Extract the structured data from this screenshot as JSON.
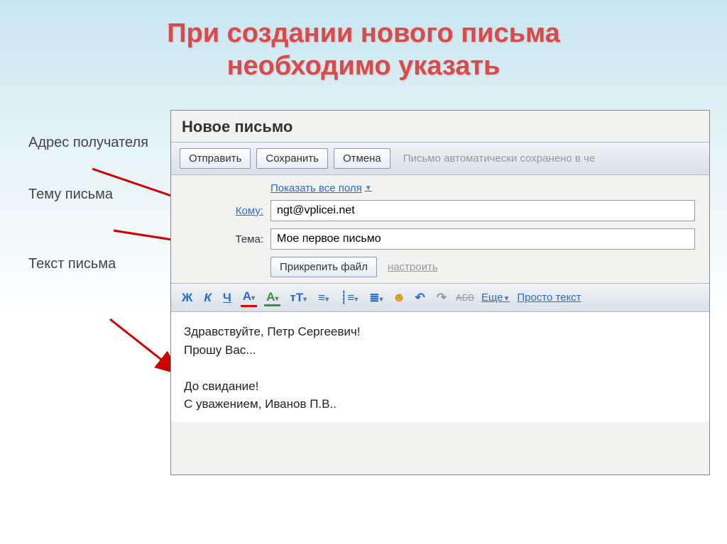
{
  "slide": {
    "title_line1": "При создании нового письма",
    "title_line2": "необходимо указать"
  },
  "labels": {
    "recipient": "Адрес получателя",
    "subject": "Тему письма",
    "body": "Текст письма"
  },
  "email": {
    "window_title": "Новое письмо",
    "toolbar": {
      "send": "Отправить",
      "save": "Сохранить",
      "cancel": "Отмена",
      "status": "Письмо автоматически сохранено в че"
    },
    "show_all_fields": "Показать все поля",
    "fields": {
      "to_label": "Кому:",
      "to_value": "ngt@vplicei.net",
      "subject_label": "Тема:",
      "subject_value": "Мое первое письмо"
    },
    "attach": {
      "button": "Прикрепить файл",
      "config": "настроить"
    },
    "format": {
      "bold": "Ж",
      "italic": "К",
      "underline": "Ч",
      "font_color": "А",
      "highlight": "А",
      "font_size": "тТ",
      "more": "Еще",
      "plain_text": "Просто текст",
      "strike": "АБВ"
    },
    "body_text": "Здравствуйте, Петр Сергеевич!\nПрошу Вас...\n\nДо свидание!\nС уважением, Иванов П.В.."
  }
}
